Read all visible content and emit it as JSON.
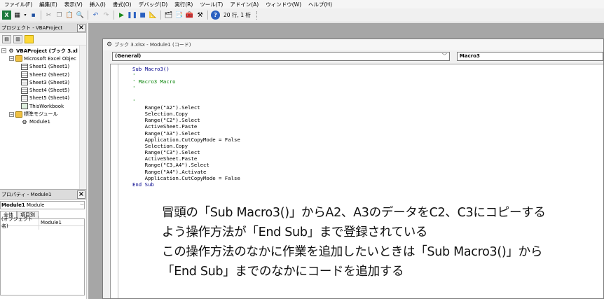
{
  "menu": [
    "ファイル(F)",
    "編集(E)",
    "表示(V)",
    "挿入(I)",
    "書式(O)",
    "デバッグ(D)",
    "実行(R)",
    "ツール(T)",
    "アドイン(A)",
    "ウィンドウ(W)",
    "ヘルプ(H)"
  ],
  "toolbar": {
    "status": "20 行, 1 桁"
  },
  "project": {
    "title": "プロジェクト - VBAProject",
    "tree": [
      {
        "label": "VBAProject (ブック 3.xl",
        "level": 0,
        "icon": "vbaproject-icon",
        "toggle": "−",
        "bold": true
      },
      {
        "label": "Microsoft Excel Objec",
        "level": 1,
        "icon": "folder-icon",
        "toggle": "−"
      },
      {
        "label": "Sheet1 (Sheet1)",
        "level": 2,
        "icon": "sheet-icon"
      },
      {
        "label": "Sheet2 (Sheet2)",
        "level": 2,
        "icon": "sheet-icon"
      },
      {
        "label": "Sheet3 (Sheet3)",
        "level": 2,
        "icon": "sheet-icon"
      },
      {
        "label": "Sheet4 (Sheet5)",
        "level": 2,
        "icon": "sheet-icon"
      },
      {
        "label": "Sheet5 (Sheet4)",
        "level": 2,
        "icon": "sheet-icon"
      },
      {
        "label": "ThisWorkbook",
        "level": 2,
        "icon": "workbook-icon"
      },
      {
        "label": "標準モジュール",
        "level": 1,
        "icon": "folder-icon",
        "toggle": "−"
      },
      {
        "label": "Module1",
        "level": 2,
        "icon": "module-icon"
      }
    ]
  },
  "properties": {
    "title": "プロパティ - Module1",
    "selected": "Module1",
    "selected_type": "Module",
    "tabs": [
      "全体",
      "項目別"
    ],
    "rows": [
      {
        "key": "(オブジェクト名)",
        "value": "Module1"
      }
    ]
  },
  "codewindow": {
    "title": "ブック 3.xlsx - Module1 (コード)",
    "object_combo": "(General)",
    "proc_combo": "Macro3",
    "lines": [
      "Sub Macro3()",
      "'",
      "' Macro3 Macro",
      "'",
      "",
      "'",
      "    Range(\"A2\").Select",
      "    Selection.Copy",
      "    Range(\"C2\").Select",
      "    ActiveSheet.Paste",
      "    Range(\"A3\").Select",
      "    Application.CutCopyMode = False",
      "    Selection.Copy",
      "    Range(\"C3\").Select",
      "    ActiveSheet.Paste",
      "    Range(\"C3,A4\").Select",
      "    Range(\"A4\").Activate",
      "    Application.CutCopyMode = False",
      "End Sub",
      ""
    ]
  },
  "annotation": [
    "冒頭の「Sub Macro3()」からA2、A3のデータをC2、C3にコピーする",
    "よう操作方法が「End Sub」まで登録されている",
    "この操作方法のなかに作業を追加したいときは「Sub Macro3()」から",
    "「End Sub」までのなかにコードを追加する"
  ],
  "colors": {
    "comment": "#008000",
    "keyword": "#00008b",
    "mdi_bg": "#a6a6a6"
  }
}
